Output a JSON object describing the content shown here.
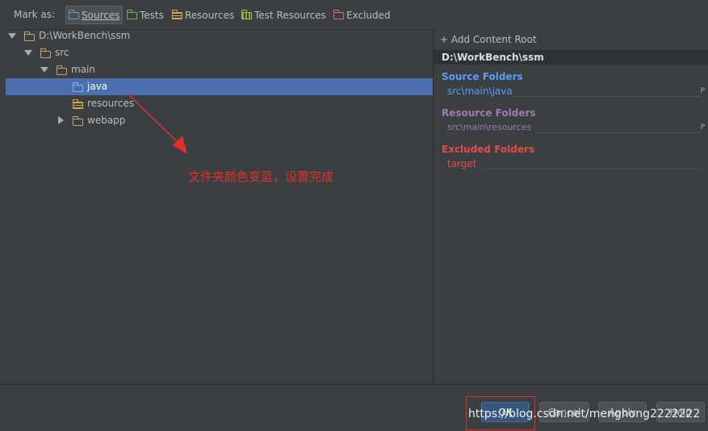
{
  "toolbar": {
    "mark_as": "Mark as:",
    "buttons": {
      "sources": "Sources",
      "tests": "Tests",
      "resources": "Resources",
      "test_resources": "Test Resources",
      "excluded": "Excluded"
    }
  },
  "tree": {
    "root": "D:\\WorkBench\\ssm",
    "src": "src",
    "main": "main",
    "java": "java",
    "resources": "resources",
    "webapp": "webapp"
  },
  "right_panel": {
    "add_content_root": "+ Add Content Root",
    "root_path": "D:\\WorkBench\\ssm",
    "source_folders_title": "Source Folders",
    "source_folder": "src\\main\\java",
    "resource_folders_title": "Resource Folders",
    "resource_folder": "src\\main\\resources",
    "excluded_folders_title": "Excluded Folders",
    "excluded_folder": "target",
    "p_mark": "P",
    "colors": {
      "source": "#589df6",
      "resource": "#9b7bb5",
      "excluded": "#e34c4c"
    }
  },
  "annotation": {
    "text": "文件夹颜色变蓝，设置完成"
  },
  "buttons": {
    "ok": "OK",
    "cancel": "Cancel",
    "apply": "Apply",
    "help": "Help"
  },
  "watermark": "https://blog.csdn.net/menghong2222222"
}
